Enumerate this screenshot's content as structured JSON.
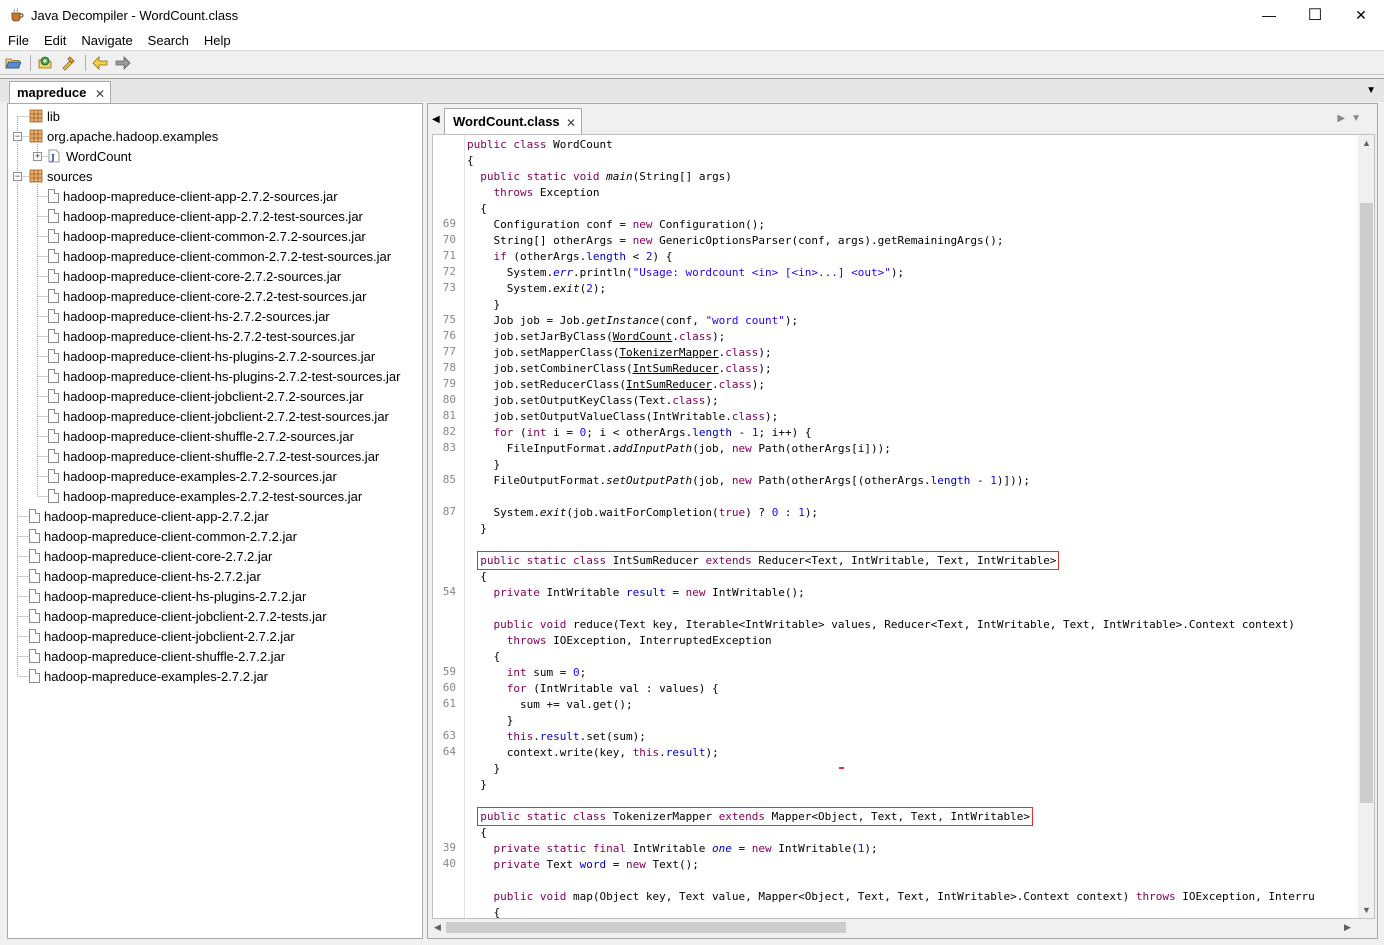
{
  "window": {
    "title": "Java Decompiler - WordCount.class",
    "minimize": "—",
    "maximize": "☐",
    "close": "✕"
  },
  "menu": [
    "File",
    "Edit",
    "Navigate",
    "Search",
    "Help"
  ],
  "toolbar": {
    "icons": [
      "open-file-icon",
      "open-type-icon",
      "search-icon",
      "back-icon",
      "forward-icon"
    ]
  },
  "outer_tab": {
    "label": "mapreduce",
    "close": "✕"
  },
  "tree": {
    "items": [
      {
        "label": "lib",
        "icon": "package-icon",
        "level": 0
      },
      {
        "label": "org.apache.hadoop.examples",
        "icon": "package-icon",
        "level": 0
      },
      {
        "label": "WordCount",
        "icon": "class-file-icon",
        "level": 1
      },
      {
        "label": "sources",
        "icon": "package-icon",
        "level": 0
      },
      {
        "label": "hadoop-mapreduce-client-app-2.7.2-sources.jar",
        "icon": "file-icon",
        "level": 1
      },
      {
        "label": "hadoop-mapreduce-client-app-2.7.2-test-sources.jar",
        "icon": "file-icon",
        "level": 1
      },
      {
        "label": "hadoop-mapreduce-client-common-2.7.2-sources.jar",
        "icon": "file-icon",
        "level": 1
      },
      {
        "label": "hadoop-mapreduce-client-common-2.7.2-test-sources.jar",
        "icon": "file-icon",
        "level": 1
      },
      {
        "label": "hadoop-mapreduce-client-core-2.7.2-sources.jar",
        "icon": "file-icon",
        "level": 1
      },
      {
        "label": "hadoop-mapreduce-client-core-2.7.2-test-sources.jar",
        "icon": "file-icon",
        "level": 1
      },
      {
        "label": "hadoop-mapreduce-client-hs-2.7.2-sources.jar",
        "icon": "file-icon",
        "level": 1
      },
      {
        "label": "hadoop-mapreduce-client-hs-2.7.2-test-sources.jar",
        "icon": "file-icon",
        "level": 1
      },
      {
        "label": "hadoop-mapreduce-client-hs-plugins-2.7.2-sources.jar",
        "icon": "file-icon",
        "level": 1
      },
      {
        "label": "hadoop-mapreduce-client-hs-plugins-2.7.2-test-sources.jar",
        "icon": "file-icon",
        "level": 1
      },
      {
        "label": "hadoop-mapreduce-client-jobclient-2.7.2-sources.jar",
        "icon": "file-icon",
        "level": 1
      },
      {
        "label": "hadoop-mapreduce-client-jobclient-2.7.2-test-sources.jar",
        "icon": "file-icon",
        "level": 1
      },
      {
        "label": "hadoop-mapreduce-client-shuffle-2.7.2-sources.jar",
        "icon": "file-icon",
        "level": 1
      },
      {
        "label": "hadoop-mapreduce-client-shuffle-2.7.2-test-sources.jar",
        "icon": "file-icon",
        "level": 1
      },
      {
        "label": "hadoop-mapreduce-examples-2.7.2-sources.jar",
        "icon": "file-icon",
        "level": 1
      },
      {
        "label": "hadoop-mapreduce-examples-2.7.2-test-sources.jar",
        "icon": "file-icon",
        "level": 1
      },
      {
        "label": "hadoop-mapreduce-client-app-2.7.2.jar",
        "icon": "file-icon",
        "level": 0
      },
      {
        "label": "hadoop-mapreduce-client-common-2.7.2.jar",
        "icon": "file-icon",
        "level": 0
      },
      {
        "label": "hadoop-mapreduce-client-core-2.7.2.jar",
        "icon": "file-icon",
        "level": 0
      },
      {
        "label": "hadoop-mapreduce-client-hs-2.7.2.jar",
        "icon": "file-icon",
        "level": 0
      },
      {
        "label": "hadoop-mapreduce-client-hs-plugins-2.7.2.jar",
        "icon": "file-icon",
        "level": 0
      },
      {
        "label": "hadoop-mapreduce-client-jobclient-2.7.2-tests.jar",
        "icon": "file-icon",
        "level": 0
      },
      {
        "label": "hadoop-mapreduce-client-jobclient-2.7.2.jar",
        "icon": "file-icon",
        "level": 0
      },
      {
        "label": "hadoop-mapreduce-client-shuffle-2.7.2.jar",
        "icon": "file-icon",
        "level": 0
      },
      {
        "label": "hadoop-mapreduce-examples-2.7.2.jar",
        "icon": "file-icon",
        "level": 0
      }
    ]
  },
  "editor": {
    "tab_label": "WordCount.class",
    "tab_close": "✕",
    "lines": [
      {
        "n": "",
        "code": "<span class=\"kw\">public class</span> WordCount"
      },
      {
        "n": "",
        "code": "{"
      },
      {
        "n": "",
        "code": "  <span class=\"kw\">public static void</span> <span class=\"it\">main</span>(String[] args)"
      },
      {
        "n": "",
        "code": "    <span class=\"kw\">throws</span> Exception"
      },
      {
        "n": "",
        "code": "  {"
      },
      {
        "n": "69",
        "code": "    Configuration conf = <span class=\"kw\">new</span> Configuration();"
      },
      {
        "n": "70",
        "code": "    String[] otherArgs = <span class=\"kw\">new</span> GenericOptionsParser(conf, args).getRemainingArgs();"
      },
      {
        "n": "71",
        "code": "    <span class=\"kw\">if</span> (otherArgs.<span class=\"fld\">length</span> &lt; <span class=\"num\">2</span>) {"
      },
      {
        "n": "72",
        "code": "      System.<span class=\"fld it\">err</span>.println(<span class=\"str\">\"Usage: wordcount &lt;in&gt; [&lt;in&gt;...] &lt;out&gt;\"</span>);"
      },
      {
        "n": "73",
        "code": "      System.<span class=\"it\">exit</span>(<span class=\"num\">2</span>);"
      },
      {
        "n": "",
        "code": "    }"
      },
      {
        "n": "75",
        "code": "    Job job = Job.<span class=\"it\">getInstance</span>(conf, <span class=\"str\">\"word count\"</span>);"
      },
      {
        "n": "76",
        "code": "    job.setJarByClass(<span class=\"ul\">WordCount</span>.<span class=\"kw\">class</span>);"
      },
      {
        "n": "77",
        "code": "    job.setMapperClass(<span class=\"ul\">TokenizerMapper</span>.<span class=\"kw\">class</span>);"
      },
      {
        "n": "78",
        "code": "    job.setCombinerClass(<span class=\"ul\">IntSumReducer</span>.<span class=\"kw\">class</span>);"
      },
      {
        "n": "79",
        "code": "    job.setReducerClass(<span class=\"ul\">IntSumReducer</span>.<span class=\"kw\">class</span>);"
      },
      {
        "n": "80",
        "code": "    job.setOutputKeyClass(Text.<span class=\"kw\">class</span>);"
      },
      {
        "n": "81",
        "code": "    job.setOutputValueClass(IntWritable.<span class=\"kw\">class</span>);"
      },
      {
        "n": "82",
        "code": "    <span class=\"kw\">for</span> (<span class=\"kw\">int</span> i = <span class=\"num\">0</span>; i &lt; otherArgs.<span class=\"fld\">length</span> - <span class=\"num\">1</span>; i++) {"
      },
      {
        "n": "83",
        "code": "      FileInputFormat.<span class=\"it\">addInputPath</span>(job, <span class=\"kw\">new</span> Path(otherArgs[i]));"
      },
      {
        "n": "",
        "code": "    }"
      },
      {
        "n": "85",
        "code": "    FileOutputFormat.<span class=\"it\">setOutputPath</span>(job, <span class=\"kw\">new</span> Path(otherArgs[(otherArgs.<span class=\"fld\">length</span> - <span class=\"num\">1</span>)]));"
      },
      {
        "n": "",
        "code": ""
      },
      {
        "n": "87",
        "code": "    System.<span class=\"it\">exit</span>(job.waitForCompletion(<span class=\"kw\">true</span>) ? <span class=\"num\">0</span> : <span class=\"num\">1</span>);"
      },
      {
        "n": "",
        "code": "  }"
      },
      {
        "n": "",
        "code": ""
      },
      {
        "n": "",
        "code": "  <span class=\"boxed\"><span class=\"kw\">public static class</span> IntSumReducer <span class=\"kw\">extends</span> Reducer&lt;Text, IntWritable, Text, IntWritable&gt;</span>"
      },
      {
        "n": "",
        "code": "  {"
      },
      {
        "n": "54",
        "code": "    <span class=\"kw\">private</span> IntWritable <span class=\"fld\">result</span> = <span class=\"kw\">new</span> IntWritable();"
      },
      {
        "n": "",
        "code": ""
      },
      {
        "n": "",
        "code": "    <span class=\"kw\">public void</span> reduce(Text key, Iterable&lt;IntWritable&gt; values, Reducer&lt;Text, IntWritable, Text, IntWritable&gt;.Context context)"
      },
      {
        "n": "",
        "code": "      <span class=\"kw\">throws</span> IOException, InterruptedException"
      },
      {
        "n": "",
        "code": "    {"
      },
      {
        "n": "59",
        "code": "      <span class=\"kw\">int</span> sum = <span class=\"num\">0</span>;"
      },
      {
        "n": "60",
        "code": "      <span class=\"kw\">for</span> (IntWritable val : values) {"
      },
      {
        "n": "61",
        "code": "        sum += val.get();"
      },
      {
        "n": "",
        "code": "      }"
      },
      {
        "n": "63",
        "code": "      <span class=\"kw\">this</span>.<span class=\"fld\">result</span>.set(sum);"
      },
      {
        "n": "64",
        "code": "      context.write(key, <span class=\"kw\">this</span>.<span class=\"fld\">result</span>);"
      },
      {
        "n": "",
        "code": "    }"
      },
      {
        "n": "",
        "code": "  }"
      },
      {
        "n": "",
        "code": ""
      },
      {
        "n": "",
        "code": "  <span class=\"boxed\"><span class=\"kw\">public static class</span> TokenizerMapper <span class=\"kw\">extends</span> Mapper&lt;Object, Text, Text, IntWritable&gt;</span>"
      },
      {
        "n": "",
        "code": "  {"
      },
      {
        "n": "39",
        "code": "    <span class=\"kw\">private static final</span> IntWritable <span class=\"fld it\">one</span> = <span class=\"kw\">new</span> IntWritable(<span class=\"num\">1</span>);"
      },
      {
        "n": "40",
        "code": "    <span class=\"kw\">private</span> Text <span class=\"fld\">word</span> = <span class=\"kw\">new</span> Text();"
      },
      {
        "n": "",
        "code": ""
      },
      {
        "n": "",
        "code": "    <span class=\"kw\">public void</span> map(Object key, Text value, Mapper&lt;Object, Text, Text, IntWritable&gt;.Context context) <span class=\"kw\">throws</span> IOException, Interru"
      },
      {
        "n": "",
        "code": "    {"
      }
    ]
  },
  "colors": {
    "keyword": "#7f0055",
    "string": "#2a00ff",
    "field": "#0000c0",
    "highlight_box": "#e03030"
  }
}
